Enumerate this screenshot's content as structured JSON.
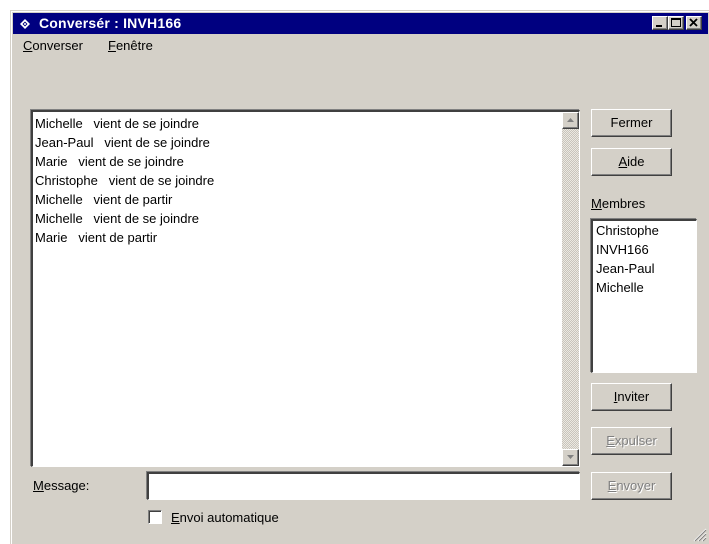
{
  "window": {
    "title": "Conversér : INVH166",
    "colors": {
      "titlebar": "#000080",
      "face": "#d4d0c8"
    }
  },
  "titlebar_buttons": {
    "minimize_icon": "minimize-icon",
    "maximize_icon": "maximize-icon",
    "close_icon": "close-icon"
  },
  "menu": {
    "items": [
      {
        "mnemonic": "C",
        "rest": "onverser"
      },
      {
        "mnemonic": "F",
        "rest": "enêtre"
      }
    ]
  },
  "chat": {
    "lines": [
      "Michelle   vient de se joindre",
      "Jean-Paul   vient de se joindre",
      "Marie   vient de se joindre",
      "Christophe   vient de se joindre",
      "Michelle   vient de partir",
      "Michelle   vient de se joindre",
      "Marie   vient de partir"
    ]
  },
  "buttons": {
    "fermer": "Fermer",
    "aide_mn": "A",
    "aide_rest": "ide",
    "inviter_mn": "I",
    "inviter_rest": "nviter",
    "expulser_mn": "E",
    "expulser_rest": "xpulser",
    "envoyer_mn": "E",
    "envoyer_rest": "nvoyer"
  },
  "members": {
    "label_mn": "M",
    "label_rest": "embres",
    "items": [
      "Christophe",
      "INVH166",
      "Jean-Paul",
      "Michelle"
    ]
  },
  "message": {
    "label_mn": "M",
    "label_rest": "essage:",
    "value": ""
  },
  "auto_send": {
    "label_mn": "E",
    "label_rest": "nvoi automatique",
    "checked": false
  }
}
